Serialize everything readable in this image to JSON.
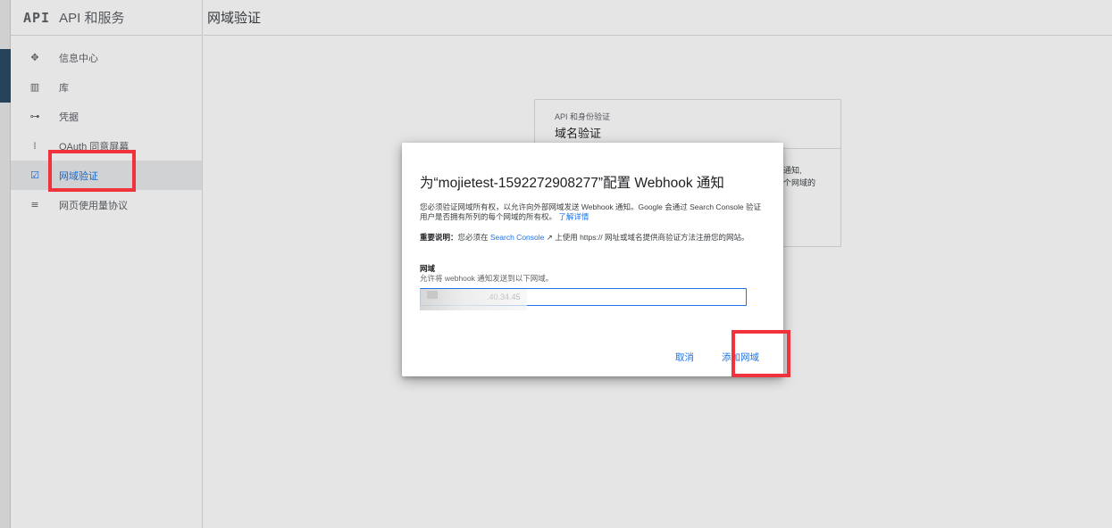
{
  "sidebar": {
    "logo": "API",
    "title": "API 和服务",
    "items": [
      {
        "icon": "dashboard-icon",
        "glyph": "✥",
        "label": "信息中心"
      },
      {
        "icon": "library-icon",
        "glyph": "▥",
        "label": "库"
      },
      {
        "icon": "key-icon",
        "glyph": "⊶",
        "label": "凭据"
      },
      {
        "icon": "consent-icon",
        "glyph": "⁞",
        "label": "OAuth 同意屏幕"
      },
      {
        "icon": "domain-verify-icon",
        "glyph": "☑",
        "label": "网域验证"
      },
      {
        "icon": "settings-list-icon",
        "glyph": "≡",
        "label": "网页使用量协议"
      }
    ]
  },
  "header": {
    "title": "网域验证"
  },
  "bg_card": {
    "subtitle": "API 和身份验证",
    "title": "域名验证",
    "frag1": "通知,",
    "frag2": "个网域的"
  },
  "dialog": {
    "title": "为“mojietest-1592272908277”配置 Webhook 通知",
    "desc": "您必须验证网域所有权，以允许向外部网域发送 Webhook 通知。Google 会通过 Search Console 验证用户是否拥有所列的每个网域的所有权。",
    "learn_more": "了解详情",
    "note_label": "重要说明：",
    "note_pre": "您必须在 ",
    "note_link": "Search Console",
    "note_post": " ↗ 上使用 https:// 网址或域名提供商验证方法注册您的网站。",
    "field_label": "网域",
    "field_help": "允许将 webhook 通知发送到以下网域。",
    "field_value": "                            .40.34.45",
    "cancel": "取消",
    "add_domain": "添加网域"
  },
  "colors": {
    "accent": "#1a73e8",
    "annotation": "#f0323c"
  }
}
